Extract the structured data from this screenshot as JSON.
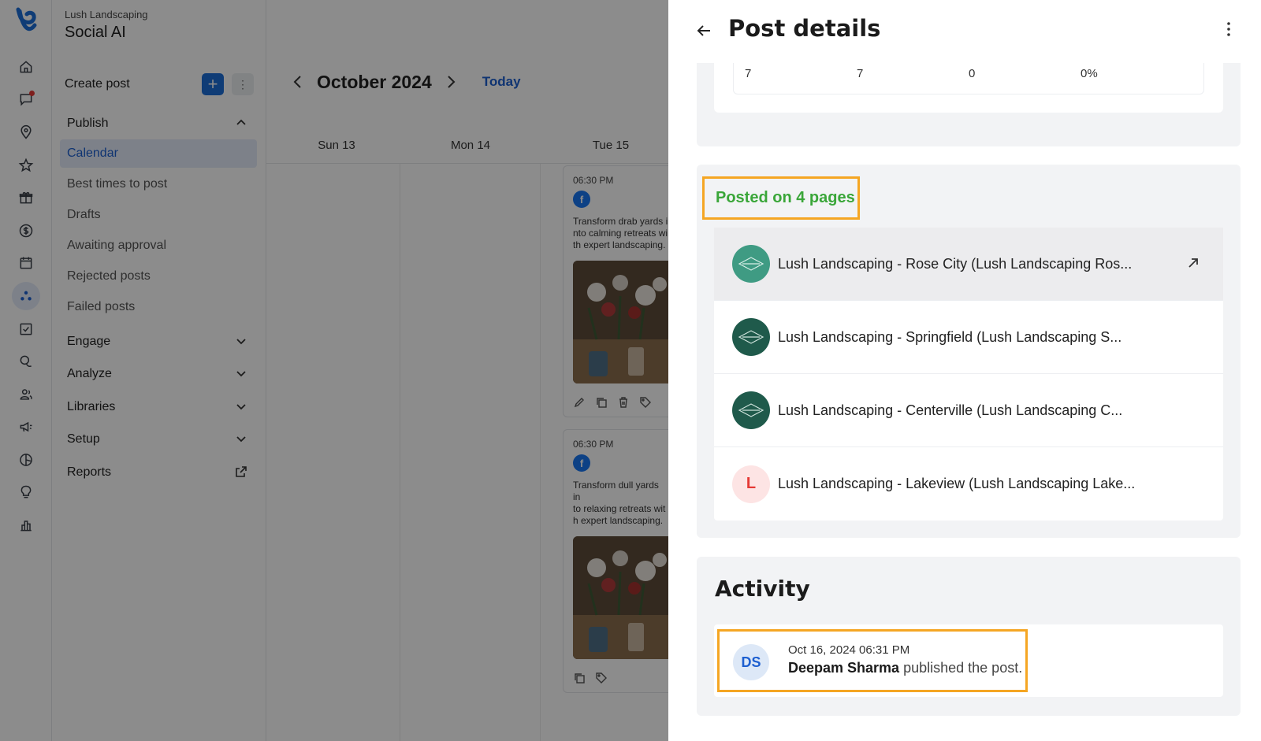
{
  "app": {
    "org": "Lush Landscaping",
    "product": "Social AI"
  },
  "sidenav": {
    "create_post": "Create post",
    "groups": {
      "publish": "Publish",
      "engage": "Engage",
      "analyze": "Analyze",
      "libraries": "Libraries",
      "setup": "Setup",
      "reports": "Reports"
    },
    "publish_items": [
      "Calendar",
      "Best times to post",
      "Drafts",
      "Awaiting approval",
      "Rejected posts",
      "Failed posts"
    ]
  },
  "calendar": {
    "month": "October 2024",
    "today": "Today",
    "days": [
      "Sun 13",
      "Mon 14",
      "Tue 15"
    ],
    "posts": [
      {
        "time": "06:30 PM",
        "text": "Transform drab yards i\nnto calming retreats wi\nth expert landscaping."
      },
      {
        "time": "06:30 PM",
        "text": "Transform dull yards in\nto relaxing retreats wit\nh expert landscaping."
      }
    ]
  },
  "panel": {
    "title": "Post details",
    "stats": [
      "7",
      "7",
      "0",
      "0%"
    ],
    "posted_on": "Posted on 4 pages",
    "pages": [
      {
        "name": "Lush Landscaping - Rose City (Lush Landscaping Ros...",
        "avatar": "logo",
        "color": "#3f9b83"
      },
      {
        "name": "Lush Landscaping - Springfield (Lush Landscaping S...",
        "avatar": "logo",
        "color": "#1f5a4b"
      },
      {
        "name": "Lush Landscaping - Centerville (Lush Landscaping C...",
        "avatar": "logo",
        "color": "#1f5a4b"
      },
      {
        "name": "Lush Landscaping - Lakeview (Lush Landscaping Lake...",
        "avatar": "L",
        "color": "#fde4e4"
      }
    ],
    "activity": {
      "title": "Activity",
      "initials": "DS",
      "time": "Oct 16, 2024 06:31 PM",
      "user": "Deepam Sharma",
      "action": "published the post."
    }
  },
  "colors": {
    "accent": "#1d6ed8",
    "highlight": "#f5a623",
    "posted_green": "#3aa639"
  }
}
